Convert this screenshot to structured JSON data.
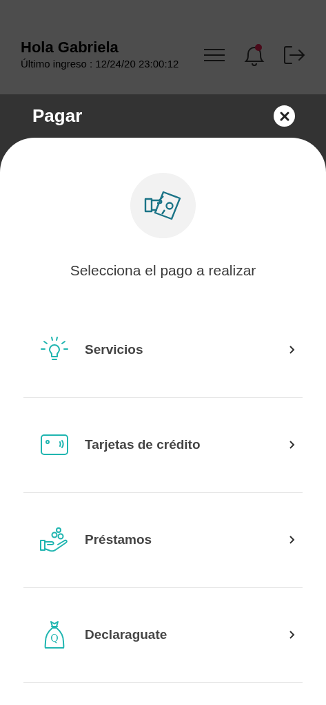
{
  "header": {
    "greeting": "Hola Gabriela",
    "last_login": "Último ingreso : 12/24/20 23:00:12",
    "has_notification": true
  },
  "sheet": {
    "title": "Pagar",
    "prompt": "Selecciona el pago a realizar",
    "options": [
      {
        "kind": "bulb",
        "label": "Servicios"
      },
      {
        "kind": "card",
        "label": "Tarjetas de crédito"
      },
      {
        "kind": "coins",
        "label": "Préstamos"
      },
      {
        "kind": "bag",
        "label": "Declaraguate",
        "icon_text": "Q"
      }
    ]
  }
}
